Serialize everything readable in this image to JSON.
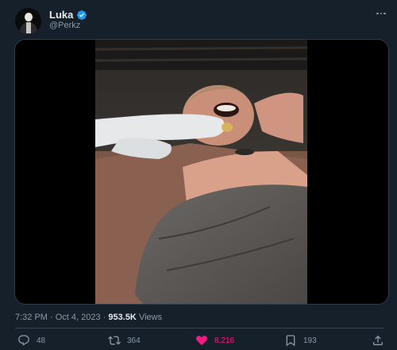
{
  "author": {
    "display_name": "Luka",
    "handle": "@Perkz",
    "verified": true
  },
  "icons": {
    "avatar": "avatar",
    "verified": "verified-badge-icon",
    "more": "more-icon",
    "reply": "reply-icon",
    "retweet": "retweet-icon",
    "like": "heart-icon",
    "bookmark": "bookmark-icon",
    "share": "share-icon"
  },
  "post": {
    "media_type": "video"
  },
  "meta": {
    "timestamp": "7:32 PM · Oct 4, 2023",
    "separator": " · ",
    "views_count": "953.5K",
    "views_label": " Views"
  },
  "actions": {
    "replies": "48",
    "retweets": "364",
    "likes": "8,216",
    "bookmarks": "193"
  },
  "colors": {
    "background": "#15202b",
    "secondary_text": "#8b98a5",
    "verified": "#1d9bf0",
    "like_active": "#f91880"
  }
}
